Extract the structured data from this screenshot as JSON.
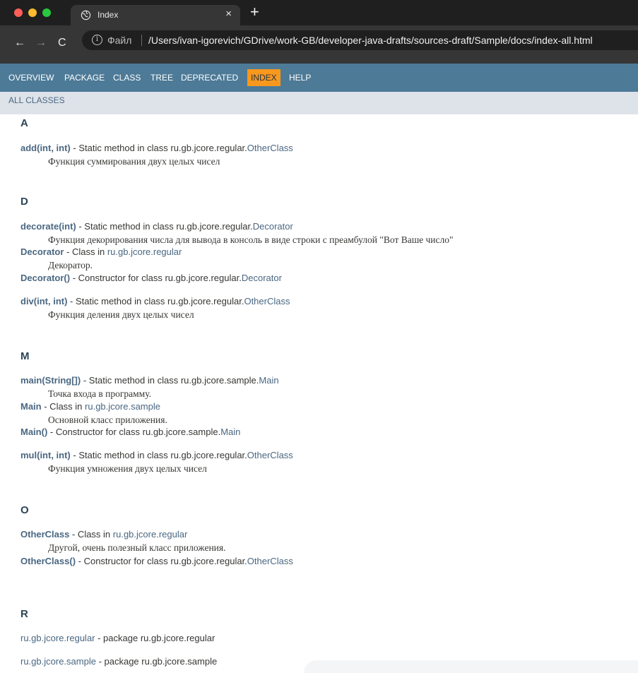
{
  "browser": {
    "tab_title": "Index",
    "tab_close": "×",
    "new_tab": "+",
    "back": "←",
    "forward": "→",
    "reload": "C",
    "site_label": "Файл",
    "url": "/Users/ivan-igorevich/GDrive/work-GB/developer-java-drafts/sources-draft/Sample/docs/index-all.html"
  },
  "topnav": {
    "items": [
      {
        "label": "OVERVIEW",
        "active": false
      },
      {
        "label": "PACKAGE",
        "active": false
      },
      {
        "label": "CLASS",
        "active": false
      },
      {
        "label": "TREE",
        "active": false
      },
      {
        "label": "DEPRECATED",
        "active": false
      },
      {
        "label": "INDEX",
        "active": true
      },
      {
        "label": "HELP",
        "active": false
      }
    ]
  },
  "subnav": {
    "all_classes": "ALL CLASSES"
  },
  "index": {
    "A": {
      "letter": "A",
      "e0": {
        "name": "add(int, int)",
        "text": " - Static method in class ru.gb.jcore.regular.",
        "link": "OtherClass",
        "desc": "Функция суммирования двух целых чисел"
      }
    },
    "D": {
      "letter": "D",
      "e0": {
        "name": "decorate(int)",
        "text": " - Static method in class ru.gb.jcore.regular.",
        "link": "Decorator",
        "desc": "Функция декорирования числа для вывода в консоль в виде строки с преамбулой \"Вот Ваше число\""
      },
      "e1": {
        "name": "Decorator",
        "text": " - Class in ",
        "link": "ru.gb.jcore.regular",
        "desc": "Декоратор."
      },
      "e2": {
        "name": "Decorator()",
        "text": " - Constructor for class ru.gb.jcore.regular.",
        "link": "Decorator"
      },
      "e3": {
        "name": "div(int, int)",
        "text": " - Static method in class ru.gb.jcore.regular.",
        "link": "OtherClass",
        "desc": "Функция деления двух целых чисел"
      }
    },
    "M": {
      "letter": "M",
      "e0": {
        "name": "main(String[])",
        "text": " - Static method in class ru.gb.jcore.sample.",
        "link": "Main",
        "desc": "Точка входа в программу."
      },
      "e1": {
        "name": "Main",
        "text": " - Class in ",
        "link": "ru.gb.jcore.sample",
        "desc": "Основной класс приложения."
      },
      "e2": {
        "name": "Main()",
        "text": " - Constructor for class ru.gb.jcore.sample.",
        "link": "Main"
      },
      "e3": {
        "name": "mul(int, int)",
        "text": " - Static method in class ru.gb.jcore.regular.",
        "link": "OtherClass",
        "desc": "Функция умножения двух целых чисел"
      }
    },
    "O": {
      "letter": "O",
      "e0": {
        "name": "OtherClass",
        "text": " - Class in ",
        "link": "ru.gb.jcore.regular",
        "desc": "Другой, очень полезный класс приложения."
      },
      "e1": {
        "name": "OtherClass()",
        "text": " - Constructor for class ru.gb.jcore.regular.",
        "link": "OtherClass"
      }
    },
    "R": {
      "letter": "R",
      "e0": {
        "link": "ru.gb.jcore.regular",
        "text": " - package ru.gb.jcore.regular"
      },
      "e1": {
        "link": "ru.gb.jcore.sample",
        "text": " - package ru.gb.jcore.sample"
      }
    }
  }
}
